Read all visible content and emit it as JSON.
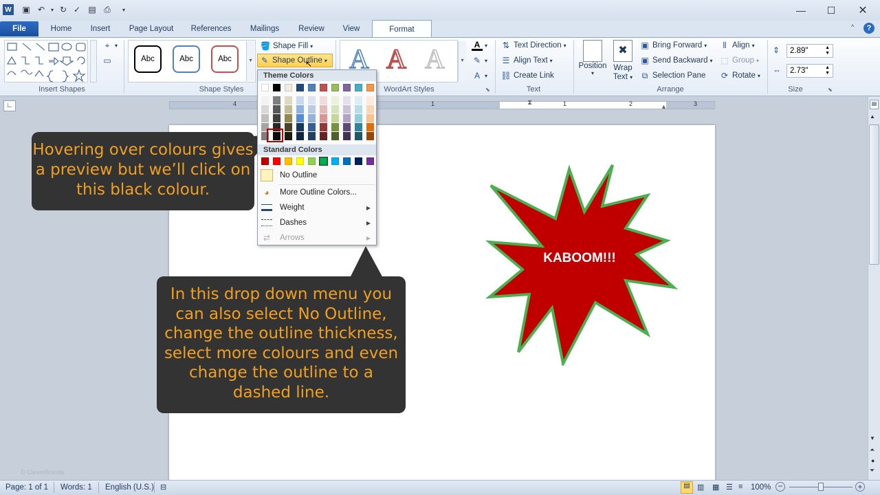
{
  "titlebar": {
    "quick_access": [
      "word-logo-icon",
      "save-icon",
      "undo-icon",
      "redo-icon",
      "spelling-icon",
      "format-painter-icon",
      "print-preview-icon",
      "customize-icon"
    ]
  },
  "tabs": {
    "file": "File",
    "home": "Home",
    "insert": "Insert",
    "page_layout": "Page Layout",
    "references": "References",
    "mailings": "Mailings",
    "review": "Review",
    "view": "View",
    "format": "Format"
  },
  "ribbon": {
    "insert_shapes_label": "Insert Shapes",
    "shape_styles_label": "Shape Styles",
    "abc1": "Abc",
    "abc2": "Abc",
    "abc3": "Abc",
    "shape_fill": "Shape Fill",
    "shape_outline": "Shape Outline",
    "wordart_styles_label": "WordArt Styles",
    "wordart_letter": "A",
    "text_direction": "Text Direction",
    "align_text": "Align Text",
    "create_link": "Create Link",
    "text_label": "Text",
    "position": "Position",
    "wrap_text_1": "Wrap",
    "wrap_text_2": "Text",
    "bring_forward": "Bring Forward",
    "send_backward": "Send Backward",
    "selection_pane": "Selection Pane",
    "align": "Align",
    "group": "Group",
    "rotate": "Rotate",
    "arrange_label": "Arrange",
    "height": "2.89\"",
    "width": "2.73\"",
    "size_label": "Size"
  },
  "ruler": {
    "numbers": [
      "4",
      "3",
      "2",
      "1",
      "1",
      "1",
      "2",
      "3"
    ]
  },
  "menu": {
    "theme_colors": "Theme Colors",
    "standard_colors": "Standard Colors",
    "no_outline": "No Outline",
    "more_colors": "More Outline Colors...",
    "weight": "Weight",
    "dashes": "Dashes",
    "arrows": "Arrows",
    "theme_top": [
      "#ffffff",
      "#000000",
      "#eeece1",
      "#1f497d",
      "#4f81bd",
      "#c0504d",
      "#9bbb59",
      "#8064a2",
      "#4bacc6",
      "#f79646"
    ],
    "theme_shades": [
      [
        "#f2f2f2",
        "#7f7f7f",
        "#ddd9c3",
        "#c6d9f0",
        "#dbe5f1",
        "#f2dcdb",
        "#ebf1dd",
        "#e5e0ec",
        "#dbeef3",
        "#fdeada"
      ],
      [
        "#d8d8d8",
        "#595959",
        "#c4bd97",
        "#8db3e2",
        "#b8cce4",
        "#e5b9b7",
        "#d7e3bc",
        "#ccc1d9",
        "#b7dde8",
        "#fbd5b5"
      ],
      [
        "#bfbfbf",
        "#3f3f3f",
        "#938953",
        "#548dd4",
        "#95b3d7",
        "#d99694",
        "#c3d69b",
        "#b2a2c7",
        "#92cddc",
        "#fac08f"
      ],
      [
        "#a5a5a5",
        "#262626",
        "#494429",
        "#17365d",
        "#366092",
        "#953734",
        "#76923c",
        "#5f497a",
        "#31859b",
        "#e36c09"
      ],
      [
        "#7f7f7f",
        "#0c0c0c",
        "#1d1b10",
        "#0f243e",
        "#244061",
        "#632423",
        "#4f6128",
        "#3f3151",
        "#205867",
        "#974806"
      ]
    ],
    "standard": [
      "#c00000",
      "#ff0000",
      "#ffc000",
      "#ffff00",
      "#92d050",
      "#00b050",
      "#00b0f0",
      "#0070c0",
      "#002060",
      "#7030a0"
    ]
  },
  "document": {
    "starburst_text": "KABOOM!!!",
    "starburst_fill": "#c00000",
    "starburst_outline": "#4caf50"
  },
  "callouts": {
    "hover_text": "Hovering over colours gives a preview but we’ll click on this black colour.",
    "dropdown_text": "In this drop down menu you can also select No Outline, change the outline thickness, select more colours and even change the outline to a dashed line."
  },
  "status": {
    "page": "Page: 1 of 1",
    "words": "Words: 1",
    "language": "English (U.S.)",
    "zoom": "100%"
  },
  "watermark": "© CleverBrands"
}
